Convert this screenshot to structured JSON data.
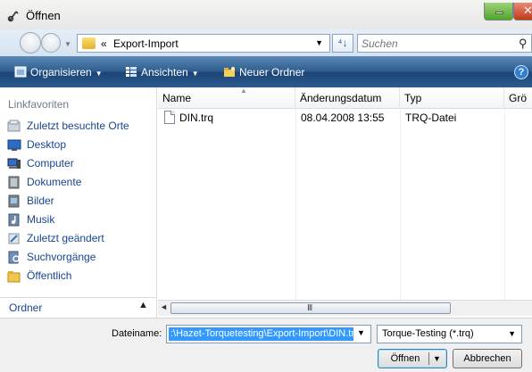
{
  "window": {
    "title": "Öffnen"
  },
  "address": {
    "path_prefix": "«",
    "path": "Export-Import"
  },
  "search": {
    "placeholder": "Suchen"
  },
  "toolbar": {
    "organize": "Organisieren",
    "views": "Ansichten",
    "new_folder": "Neuer Ordner",
    "help": "?"
  },
  "favorites": {
    "heading": "Linkfavoriten",
    "items": [
      {
        "label": "Zuletzt besuchte Orte",
        "icon": "recent-places-icon"
      },
      {
        "label": "Desktop",
        "icon": "desktop-icon"
      },
      {
        "label": "Computer",
        "icon": "computer-icon"
      },
      {
        "label": "Dokumente",
        "icon": "documents-icon"
      },
      {
        "label": "Bilder",
        "icon": "pictures-icon"
      },
      {
        "label": "Musik",
        "icon": "music-icon"
      },
      {
        "label": "Zuletzt geändert",
        "icon": "recently-changed-icon"
      },
      {
        "label": "Suchvorgänge",
        "icon": "searches-icon"
      },
      {
        "label": "Öffentlich",
        "icon": "public-folder-icon"
      }
    ]
  },
  "folders": {
    "label": "Ordner"
  },
  "columns": {
    "name": "Name",
    "date": "Änderungsdatum",
    "type": "Typ",
    "size": "Grö"
  },
  "files": [
    {
      "name": "DIN.trq",
      "date": "08.04.2008 13:55",
      "type": "TRQ-Datei"
    }
  ],
  "scrollbar": {
    "grip": "III"
  },
  "bottom": {
    "filename_label": "Dateiname:",
    "filename_value": ":\\Hazet-Torquetesting\\Export-Import\\DIN.trq",
    "filetype": "Torque-Testing (*.trq)",
    "open_label": "Öffnen",
    "cancel_label": "Abbrechen"
  },
  "colors": {
    "toolbar": "#2c5a8c",
    "link": "#17458f",
    "selection": "#3399ff"
  }
}
